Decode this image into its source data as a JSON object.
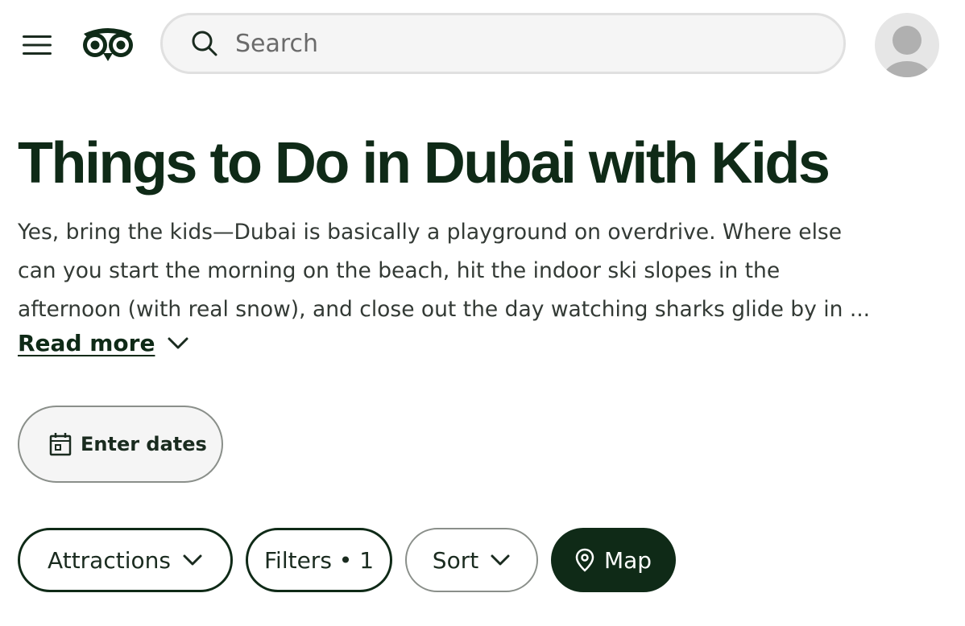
{
  "header": {
    "search_placeholder": "Search"
  },
  "page": {
    "title": "Things to Do in Dubai with Kids",
    "description_lines": [
      "Yes, bring the kids—Dubai is basically a playground on overdrive. Where else",
      "can you start the morning on the beach, hit the indoor ski slopes in the",
      "afternoon (with real snow), and close out the day watching sharks glide by in ..."
    ],
    "read_more_label": "Read more"
  },
  "actions": {
    "enter_dates_label": "Enter dates"
  },
  "filters": {
    "attractions_label": "Attractions",
    "filters_label": "Filters • 1",
    "sort_label": "Sort",
    "map_label": "Map"
  },
  "icons": {
    "menu": "hamburger-menu-icon",
    "logo": "owl-logo-icon",
    "search": "search-icon",
    "avatar": "user-avatar-icon",
    "read_more": "chevron-down-icon",
    "dates": "calendar-icon",
    "map": "map-pin-icon"
  },
  "colors": {
    "brand_dark": "#0f2a17",
    "text": "#1a2b1f",
    "search_bg": "#f5f5f5",
    "border_muted": "#8a8f8a"
  }
}
